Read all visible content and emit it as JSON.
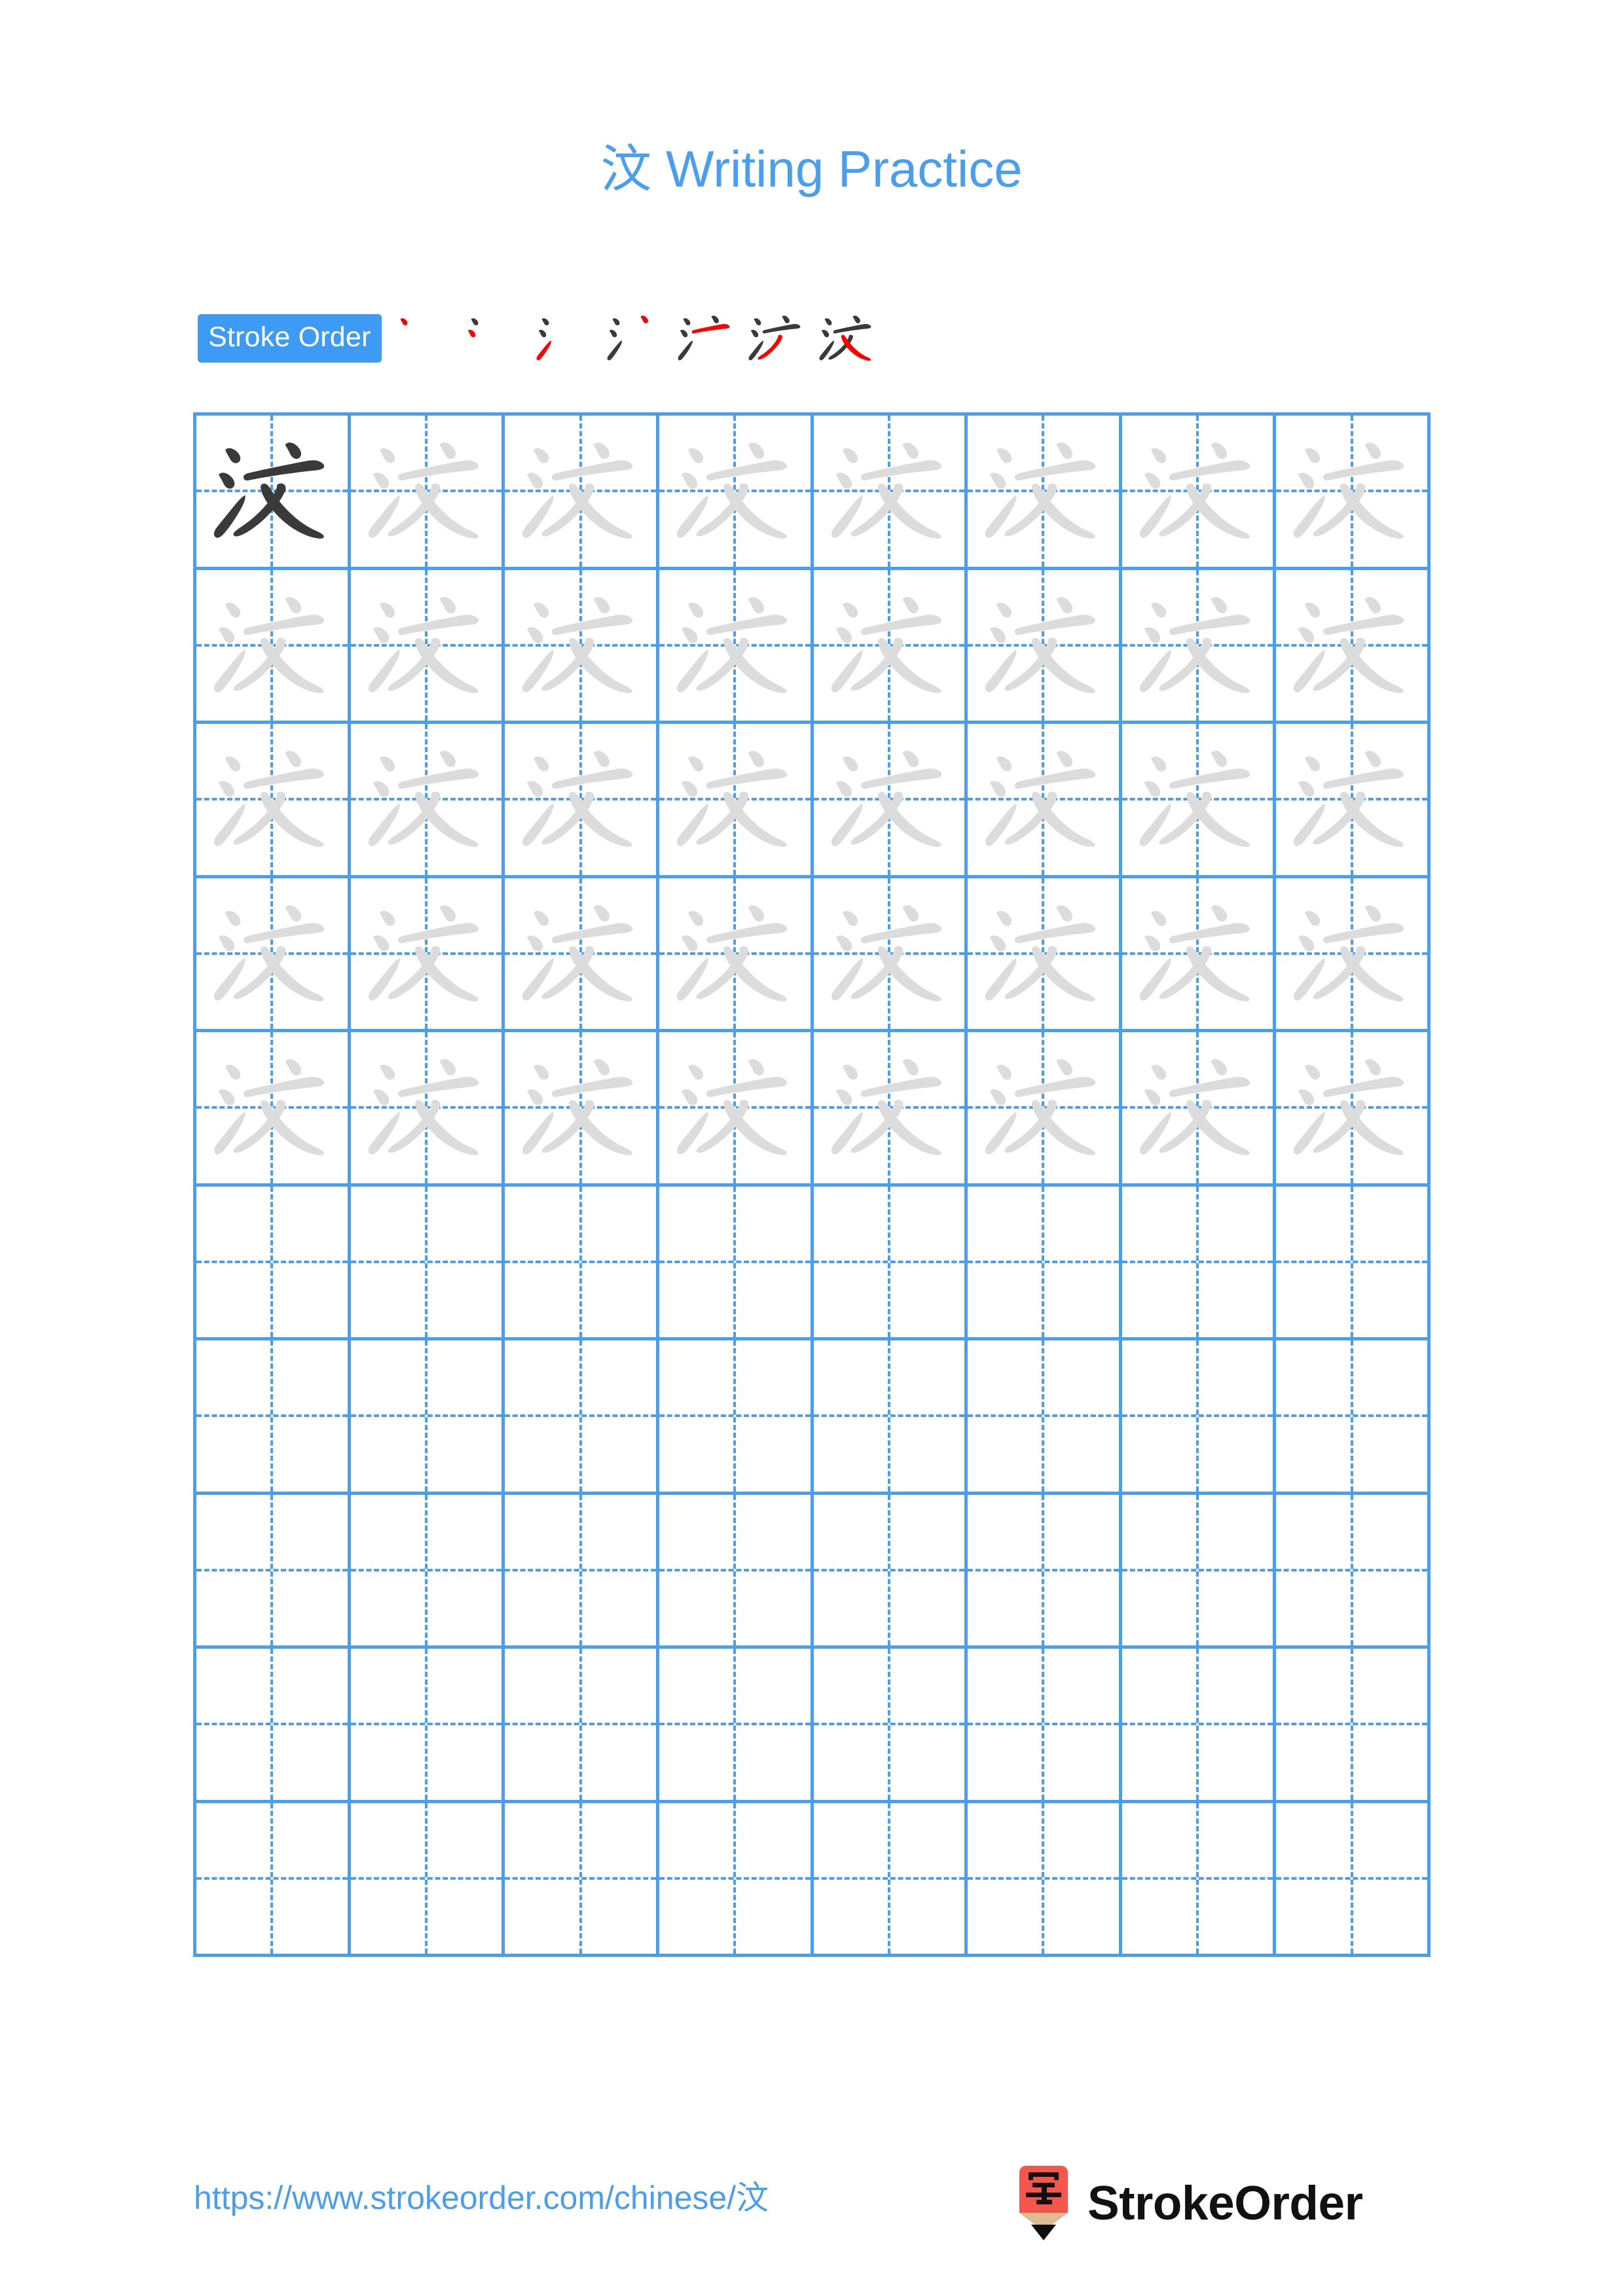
{
  "character": "汶",
  "title": {
    "character": "汶",
    "text": " Writing Practice",
    "full": "汶 Writing Practice"
  },
  "colors": {
    "accent_blue": "#4a9ef0",
    "badge_blue": "#3d9bf5",
    "grid_line": "#4a9ef0",
    "ink_dark": "#3a3a3a",
    "ink_new_stroke": "#ff0000",
    "ink_traced": "#dcdcdc",
    "logo_red": "#f4564e",
    "logo_tan": "#dfbb90",
    "logo_text": "#111111",
    "page_background": "#ffffff"
  },
  "stroke_order": {
    "label": "Stroke Order",
    "total_strokes": 7,
    "steps": [
      {
        "index": 1,
        "strokes_shown": 1,
        "new_stroke": 1
      },
      {
        "index": 2,
        "strokes_shown": 2,
        "new_stroke": 2
      },
      {
        "index": 3,
        "strokes_shown": 3,
        "new_stroke": 3
      },
      {
        "index": 4,
        "strokes_shown": 4,
        "new_stroke": 4
      },
      {
        "index": 5,
        "strokes_shown": 5,
        "new_stroke": 5
      },
      {
        "index": 6,
        "strokes_shown": 6,
        "new_stroke": 6
      },
      {
        "index": 7,
        "strokes_shown": 7,
        "new_stroke": 7
      }
    ]
  },
  "practice_grid": {
    "columns": 8,
    "rows": 10,
    "total_cells": 80,
    "cells": [
      "solid",
      "traced",
      "traced",
      "traced",
      "traced",
      "traced",
      "traced",
      "traced",
      "traced",
      "traced",
      "traced",
      "traced",
      "traced",
      "traced",
      "traced",
      "traced",
      "traced",
      "traced",
      "traced",
      "traced",
      "traced",
      "traced",
      "traced",
      "traced",
      "traced",
      "traced",
      "traced",
      "traced",
      "traced",
      "traced",
      "traced",
      "traced",
      "traced",
      "traced",
      "traced",
      "traced",
      "traced",
      "traced",
      "traced",
      "traced",
      "empty",
      "empty",
      "empty",
      "empty",
      "empty",
      "empty",
      "empty",
      "empty",
      "empty",
      "empty",
      "empty",
      "empty",
      "empty",
      "empty",
      "empty",
      "empty",
      "empty",
      "empty",
      "empty",
      "empty",
      "empty",
      "empty",
      "empty",
      "empty",
      "empty",
      "empty",
      "empty",
      "empty",
      "empty",
      "empty",
      "empty",
      "empty",
      "empty",
      "empty",
      "empty",
      "empty",
      "empty",
      "empty",
      "empty",
      "empty"
    ]
  },
  "footer": {
    "url": "https://www.strokeorder.com/chinese/汶",
    "brand_name": "StrokeOrder",
    "logo_character": "字"
  }
}
